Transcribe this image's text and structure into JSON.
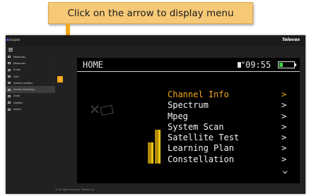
{
  "callout": {
    "text": "Click on the arrow to display menu"
  },
  "topbar": {
    "language": "English",
    "brand": "Televes"
  },
  "sidebar": {
    "items": [
      {
        "label": "Measures",
        "icon": "gauge-icon",
        "caret": ""
      },
      {
        "label": "Measures",
        "icon": "chart-icon",
        "caret": "›"
      },
      {
        "label": "Prints",
        "icon": "print-icon",
        "caret": "›"
      },
      {
        "label": "Grid",
        "icon": "grid-icon",
        "caret": "›"
      },
      {
        "label": "Quality profiles",
        "icon": "profile-icon",
        "caret": "›"
      },
      {
        "label": "Screen Mirroring",
        "icon": "screen-icon",
        "caret": ""
      },
      {
        "label": "Zone",
        "icon": "zone-icon",
        "caret": ""
      },
      {
        "label": "Update",
        "icon": "cloud-icon",
        "caret": ""
      },
      {
        "label": "About",
        "icon": "info-icon",
        "caret": ""
      }
    ],
    "active_index": 5
  },
  "menu_toggle": {
    "icon": "arrow-right-icon",
    "glyph": "›"
  },
  "device": {
    "title": "HOME",
    "time": "09:55",
    "signal_glyph": "Ψ",
    "menu": [
      {
        "label": "Channel Info",
        "arrow": ">",
        "selected": true
      },
      {
        "label": "Spectrum",
        "arrow": ">",
        "selected": false
      },
      {
        "label": "Mpeg",
        "arrow": ">",
        "selected": false
      },
      {
        "label": "System Scan",
        "arrow": ">",
        "selected": false
      },
      {
        "label": "Satellite Test",
        "arrow": ">",
        "selected": false
      },
      {
        "label": "Learning Plan",
        "arrow": ">",
        "selected": false
      },
      {
        "label": "Constellation",
        "arrow": ">",
        "selected": false
      }
    ],
    "more_glyph": "⌄",
    "battery_level": 0.25
  },
  "footer": {
    "text": "© All rights reserved, Televes S.A."
  },
  "colors": {
    "accent": "#f2a71c",
    "callout_bg": "#f6c977",
    "screen_bg": "#000000",
    "battery": "#3dd63d"
  }
}
